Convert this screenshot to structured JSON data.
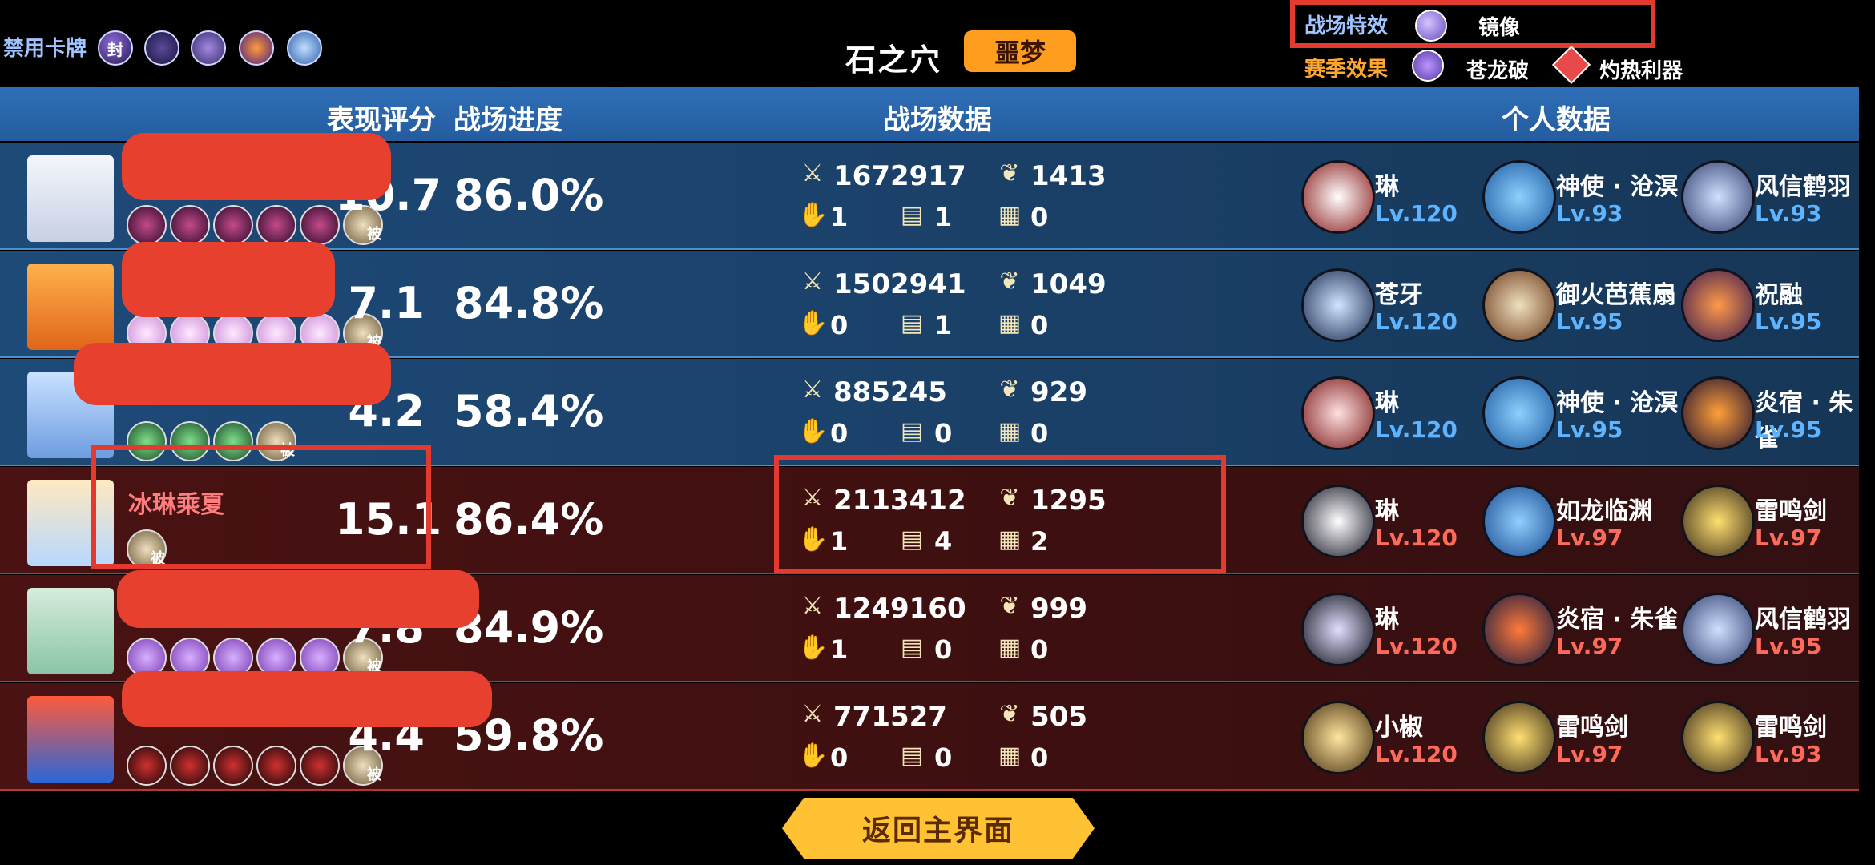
{
  "top": {
    "banned_label": "禁用卡牌",
    "banned_cards": [
      {
        "icon": "seal-card-icon",
        "glyph": "封"
      },
      {
        "icon": "purple-card-icon",
        "glyph": ""
      },
      {
        "icon": "scroll-card-icon",
        "glyph": ""
      },
      {
        "icon": "fire-card-icon",
        "glyph": ""
      },
      {
        "icon": "ghost-card-icon",
        "glyph": ""
      }
    ],
    "map_name": "石之穴",
    "difficulty": "噩梦",
    "effect_label": "战场特效",
    "effect_name": "镜像",
    "season_label": "赛季效果",
    "season_effects": [
      "苍龙破",
      "灼热利器"
    ]
  },
  "headers": {
    "score": "表现评分",
    "progress": "战场进度",
    "battle_data": "战场数据",
    "personal_data": "个人数据"
  },
  "players": [
    {
      "team": "blue",
      "name": "",
      "score": "10.7",
      "progress": "86.0%",
      "damage": "1672917",
      "kills": "1413",
      "s1": "1",
      "s2": "1",
      "s3": "0",
      "heroes": [
        {
          "name": "琳",
          "lv": "Lv.120"
        },
        {
          "name": "神使 · 沧溟",
          "lv": "Lv.93"
        },
        {
          "name": "风信鹤羽",
          "lv": "Lv.93"
        }
      ]
    },
    {
      "team": "blue",
      "name": "",
      "score": "7.1",
      "progress": "84.8%",
      "damage": "1502941",
      "kills": "1049",
      "s1": "0",
      "s2": "1",
      "s3": "0",
      "heroes": [
        {
          "name": "苍牙",
          "lv": "Lv.120"
        },
        {
          "name": "御火芭蕉扇",
          "lv": "Lv.95"
        },
        {
          "name": "祝融",
          "lv": "Lv.95"
        }
      ]
    },
    {
      "team": "blue",
      "name": "",
      "score": "4.2",
      "progress": "58.4%",
      "damage": "885245",
      "kills": "929",
      "s1": "0",
      "s2": "0",
      "s3": "0",
      "heroes": [
        {
          "name": "琳",
          "lv": "Lv.120"
        },
        {
          "name": "神使 · 沧溟",
          "lv": "Lv.95"
        },
        {
          "name": "炎宿 · 朱雀",
          "lv": "Lv.95"
        }
      ]
    },
    {
      "team": "red",
      "name": "冰琳乘夏",
      "score": "15.1",
      "progress": "86.4%",
      "damage": "2113412",
      "kills": "1295",
      "s1": "1",
      "s2": "4",
      "s3": "2",
      "heroes": [
        {
          "name": "琳",
          "lv": "Lv.120"
        },
        {
          "name": "如龙临渊",
          "lv": "Lv.97"
        },
        {
          "name": "雷鸣剑",
          "lv": "Lv.97"
        }
      ]
    },
    {
      "team": "red",
      "name": "",
      "score": "7.8",
      "progress": "84.9%",
      "damage": "1249160",
      "kills": "999",
      "s1": "1",
      "s2": "0",
      "s3": "0",
      "heroes": [
        {
          "name": "琳",
          "lv": "Lv.120"
        },
        {
          "name": "炎宿 · 朱雀",
          "lv": "Lv.97"
        },
        {
          "name": "风信鹤羽",
          "lv": "Lv.95"
        }
      ]
    },
    {
      "team": "red",
      "name": "",
      "score": "4.4",
      "progress": "59.8%",
      "damage": "771527",
      "kills": "505",
      "s1": "0",
      "s2": "0",
      "s3": "0",
      "heroes": [
        {
          "name": "小椒",
          "lv": "Lv.120"
        },
        {
          "name": "雷鸣剑",
          "lv": "Lv.97"
        },
        {
          "name": "雷鸣剑",
          "lv": "Lv.93"
        }
      ]
    }
  ],
  "badge_glyph": "被",
  "return_button": "返回主界面"
}
